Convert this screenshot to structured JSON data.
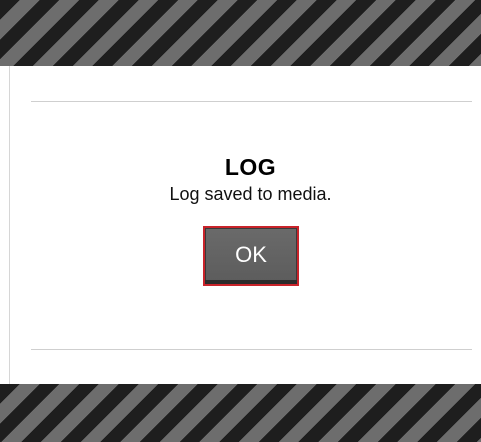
{
  "dialog": {
    "title": "LOG",
    "message": "Log saved to media.",
    "ok_label": "OK"
  },
  "colors": {
    "hazard_dark": "#1e1e1e",
    "hazard_light": "#6d6d6d",
    "button_face": "#666666",
    "button_focus_border": "#c8232a",
    "background": "#ffffff"
  }
}
